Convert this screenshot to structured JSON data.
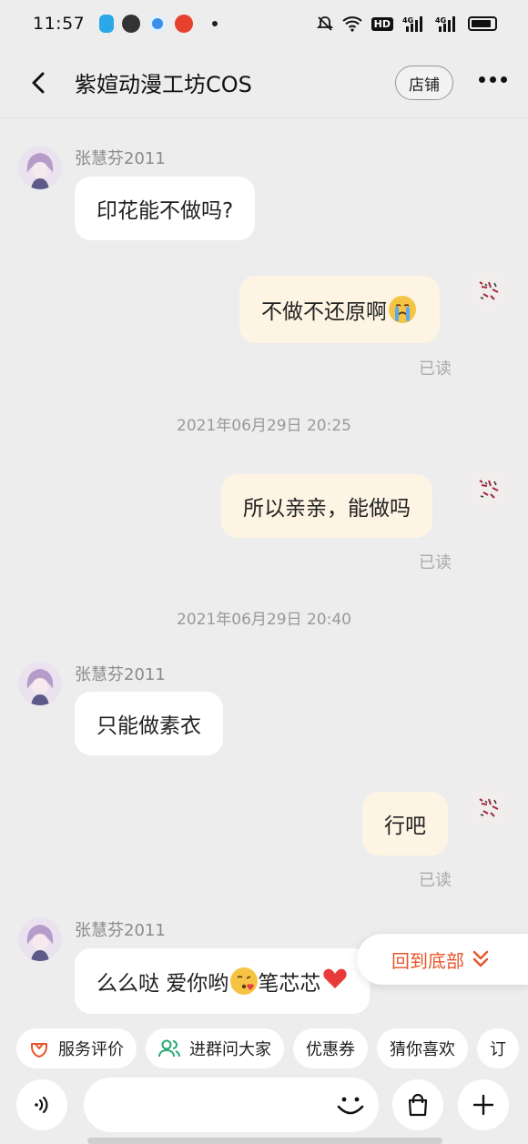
{
  "status_bar": {
    "time": "11:57",
    "right_indicators": [
      "mute-icon",
      "wifi-icon",
      "HD",
      "4G",
      "4G",
      "battery-icon"
    ]
  },
  "header": {
    "title": "紫媗动漫工坊COS",
    "store_label": "店铺"
  },
  "messages": [
    {
      "type": "in",
      "sender": "张慧芬2011",
      "text": "印花能不做吗?"
    },
    {
      "type": "out",
      "text": "不做不还原啊",
      "status": "已读"
    },
    {
      "type": "timestamp",
      "text": "2021年06月29日 20:25"
    },
    {
      "type": "out",
      "text": "所以亲亲，能做吗",
      "status": "已读"
    },
    {
      "type": "timestamp",
      "text": "2021年06月29日 20:40"
    },
    {
      "type": "in",
      "sender": "张慧芬2011",
      "text": "只能做素衣"
    },
    {
      "type": "out",
      "text": "行吧",
      "status": "已读"
    },
    {
      "type": "in",
      "sender": "张慧芬2011",
      "text_part1": "么么哒 爱你哟",
      "text_part2": " 笔芯芯"
    }
  ],
  "jump_to_bottom_label": "回到底部",
  "quick_chips": [
    {
      "label": "服务评价",
      "icon": "service-rating-icon"
    },
    {
      "label": "进群问大家",
      "icon": "group-icon"
    },
    {
      "label": "优惠券"
    },
    {
      "label": "猜你喜欢"
    },
    {
      "label": "订"
    }
  ],
  "colors": {
    "accent": "#e8552a",
    "bubble_out": "#fdf4e3",
    "bubble_in": "#ffffff",
    "background": "#ededed"
  }
}
